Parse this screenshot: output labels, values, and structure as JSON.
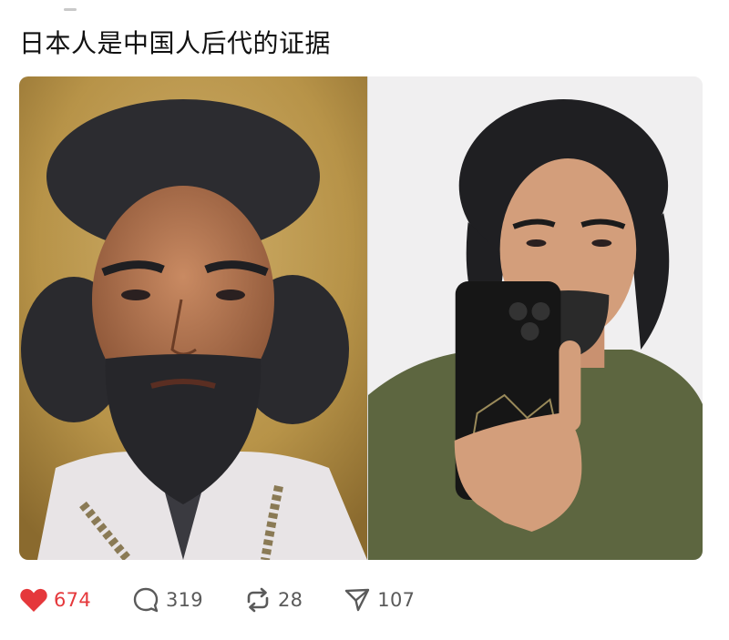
{
  "post": {
    "title": "日本人是中国人后代的证据"
  },
  "actions": {
    "like_count": "674",
    "comment_count": "319",
    "repost_count": "28",
    "share_count": "107"
  },
  "colors": {
    "like": "#e5383b",
    "icon": "#5a5a5a",
    "text": "#111111"
  }
}
